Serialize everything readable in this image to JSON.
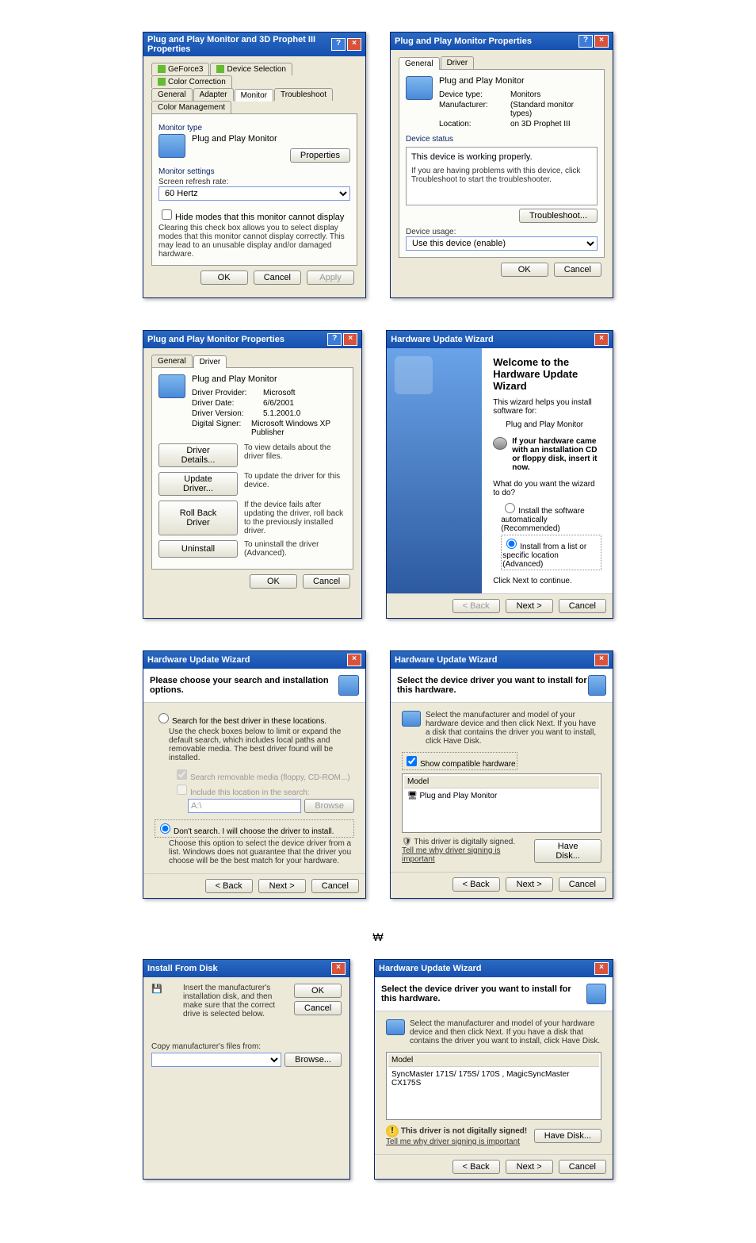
{
  "dlg1": {
    "title": "Plug and Play Monitor and 3D Prophet III Properties",
    "tabs": [
      "GeForce3",
      "Device Selection",
      "Color Correction",
      "General",
      "Adapter",
      "Monitor",
      "Troubleshoot",
      "Color Management"
    ],
    "monitorTypeLabel": "Monitor type",
    "monitorName": "Plug and Play Monitor",
    "propertiesBtn": "Properties",
    "monitorSettingsLabel": "Monitor settings",
    "refreshLabel": "Screen refresh rate:",
    "refreshValue": "60 Hertz",
    "hideModes": "Hide modes that this monitor cannot display",
    "hideModesDesc": "Clearing this check box allows you to select display modes that this monitor cannot display correctly. This may lead to an unusable display and/or damaged hardware.",
    "ok": "OK",
    "cancel": "Cancel",
    "apply": "Apply"
  },
  "dlg2": {
    "title": "Plug and Play Monitor Properties",
    "tabs": [
      "General",
      "Driver"
    ],
    "monitorName": "Plug and Play Monitor",
    "kv": [
      [
        "Device type:",
        "Monitors"
      ],
      [
        "Manufacturer:",
        "(Standard monitor types)"
      ],
      [
        "Location:",
        "on 3D Prophet III"
      ]
    ],
    "statusLabel": "Device status",
    "statusText": "This device is working properly.",
    "statusHelp": "If you are having problems with this device, click Troubleshoot to start the troubleshooter.",
    "troubleshoot": "Troubleshoot...",
    "usageLabel": "Device usage:",
    "usageValue": "Use this device (enable)",
    "ok": "OK",
    "cancel": "Cancel"
  },
  "dlg3": {
    "title": "Plug and Play Monitor Properties",
    "tabs": [
      "General",
      "Driver"
    ],
    "monitorName": "Plug and Play Monitor",
    "kv": [
      [
        "Driver Provider:",
        "Microsoft"
      ],
      [
        "Driver Date:",
        "6/6/2001"
      ],
      [
        "Driver Version:",
        "5.1.2001.0"
      ],
      [
        "Digital Signer:",
        "Microsoft Windows XP Publisher"
      ]
    ],
    "btns": [
      [
        "Driver Details...",
        "To view details about the driver files."
      ],
      [
        "Update Driver...",
        "To update the driver for this device."
      ],
      [
        "Roll Back Driver",
        "If the device fails after updating the driver, roll back to the previously installed driver."
      ],
      [
        "Uninstall",
        "To uninstall the driver (Advanced)."
      ]
    ],
    "ok": "OK",
    "cancel": "Cancel"
  },
  "dlg4": {
    "title": "Hardware Update Wizard",
    "welcome": "Welcome to the Hardware Update Wizard",
    "helps": "This wizard helps you install software for:",
    "device": "Plug and Play Monitor",
    "cdHint": "If your hardware came with an installation CD or floppy disk, insert it now.",
    "question": "What do you want the wizard to do?",
    "opt1": "Install the software automatically (Recommended)",
    "opt2": "Install from a list or specific location (Advanced)",
    "clickNext": "Click Next to continue.",
    "back": "< Back",
    "next": "Next >",
    "cancel": "Cancel"
  },
  "dlg5": {
    "title": "Hardware Update Wizard",
    "heading": "Please choose your search and installation options.",
    "opt1": "Search for the best driver in these locations.",
    "opt1desc": "Use the check boxes below to limit or expand the default search, which includes local paths and removable media. The best driver found will be installed.",
    "chk1": "Search removable media (floppy, CD-ROM...)",
    "chk2": "Include this location in the search:",
    "path": "A:\\",
    "browse": "Browse",
    "opt2": "Don't search. I will choose the driver to install.",
    "opt2desc": "Choose this option to select the device driver from a list. Windows does not guarantee that the driver you choose will be the best match for your hardware.",
    "back": "< Back",
    "next": "Next >",
    "cancel": "Cancel"
  },
  "dlg6": {
    "title": "Hardware Update Wizard",
    "heading": "Select the device driver you want to install for this hardware.",
    "desc": "Select the manufacturer and model of your hardware device and then click Next. If you have a disk that contains the driver you want to install, click Have Disk.",
    "showCompat": "Show compatible hardware",
    "modelHdr": "Model",
    "model": "Plug and Play Monitor",
    "signed": "This driver is digitally signed.",
    "tellMe": "Tell me why driver signing is important",
    "haveDisk": "Have Disk...",
    "back": "< Back",
    "next": "Next >",
    "cancel": "Cancel"
  },
  "dlg7": {
    "title": "Install From Disk",
    "text": "Insert the manufacturer's installation disk, and then make sure that the correct drive is selected below.",
    "ok": "OK",
    "cancel": "Cancel",
    "copyLabel": "Copy manufacturer's files from:",
    "browse": "Browse..."
  },
  "dlg8": {
    "title": "Hardware Update Wizard",
    "heading": "Select the device driver you want to install for this hardware.",
    "desc": "Select the manufacturer and model of your hardware device and then click Next. If you have a disk that contains the driver you want to install, click Have Disk.",
    "modelHdr": "Model",
    "model": "SyncMaster 171S/ 175S/ 170S , MagicSyncMaster CX175S",
    "notSigned": "This driver is not digitally signed!",
    "tellMe": "Tell me why driver signing is important",
    "haveDisk": "Have Disk...",
    "back": "< Back",
    "next": "Next >",
    "cancel": "Cancel"
  }
}
